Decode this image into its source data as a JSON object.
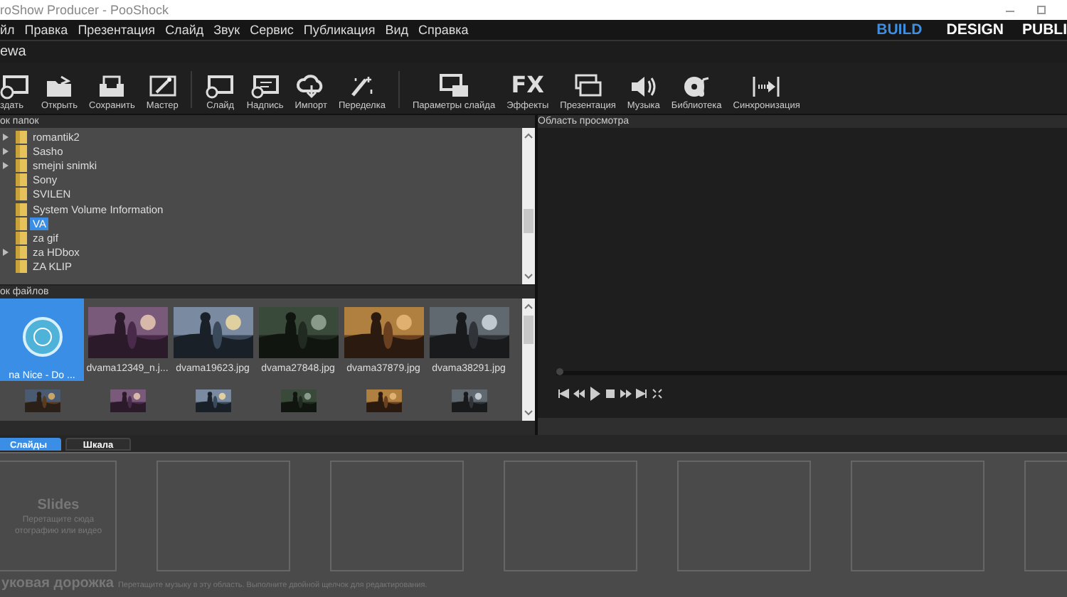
{
  "window": {
    "title": "roShow Producer - PooShock"
  },
  "menu": [
    "йл",
    "Правка",
    "Презентация",
    "Слайд",
    "Звук",
    "Сервис",
    "Публикация",
    "Вид",
    "Справка"
  ],
  "modes": [
    {
      "label": "BUILD",
      "selected": true
    },
    {
      "label": "DESIGN",
      "selected": false
    },
    {
      "label": "PUBLI",
      "selected": false
    }
  ],
  "project_tab": "ewa",
  "toolbar": [
    {
      "label": "здать"
    },
    {
      "label": "Открыть"
    },
    {
      "label": "Сохранить"
    },
    {
      "label": "Мастер",
      "group_end": true
    },
    {
      "label": "Слайд"
    },
    {
      "label": "Надпись"
    },
    {
      "label": "Импорт"
    },
    {
      "label": "Переделка",
      "group_end": true
    },
    {
      "label": "Параметры слайда"
    },
    {
      "label": "Эффекты",
      "icon_text": "FX"
    },
    {
      "label": "Презентация"
    },
    {
      "label": "Музыка"
    },
    {
      "label": "Библиотека"
    },
    {
      "label": "Синхронизация"
    }
  ],
  "folders": {
    "title": "ок папок",
    "items": [
      {
        "name": "romantik2",
        "has_children": true,
        "selected": false
      },
      {
        "name": "Sasho",
        "has_children": true,
        "selected": false
      },
      {
        "name": "smejni snimki",
        "has_children": true,
        "selected": false
      },
      {
        "name": "Sony",
        "has_children": false,
        "selected": false
      },
      {
        "name": "SVILEN",
        "has_children": false,
        "selected": false
      },
      {
        "name": "System Volume Information",
        "has_children": false,
        "selected": false
      },
      {
        "name": "VA",
        "has_children": false,
        "selected": true
      },
      {
        "name": "za gif",
        "has_children": false,
        "selected": false
      },
      {
        "name": "za HDbox",
        "has_children": true,
        "selected": false
      },
      {
        "name": "ZA KLIP",
        "has_children": false,
        "selected": false
      }
    ]
  },
  "files": {
    "title": "ок файлов",
    "items": [
      {
        "kind": "audio",
        "name": "na Nice - Do ...",
        "selected": true
      },
      {
        "kind": "picture",
        "name": "dvama12349_n.j...",
        "selected": false
      },
      {
        "kind": "picture",
        "name": "dvama19623.jpg",
        "selected": false
      },
      {
        "kind": "picture",
        "name": "dvama27848.jpg",
        "selected": false
      },
      {
        "kind": "picture",
        "name": "dvama37879.jpg",
        "selected": false
      },
      {
        "kind": "picture",
        "name": "dvama38291.jpg",
        "selected": false
      },
      {
        "kind": "picture",
        "selected": false
      },
      {
        "kind": "picture",
        "selected": false
      },
      {
        "kind": "picture",
        "selected": false
      },
      {
        "kind": "picture",
        "selected": false
      },
      {
        "kind": "picture",
        "selected": false
      },
      {
        "kind": "picture",
        "selected": false
      }
    ]
  },
  "preview": {
    "title": "Область просмотра",
    "level": 0
  },
  "bottom_tabs": [
    {
      "label": "Слайды",
      "selected": true
    },
    {
      "label": "Шкала",
      "selected": false
    }
  ],
  "slides": {
    "title": "Slides",
    "hint_1": "Перетащите сюда",
    "hint_2": "отографию или видео"
  },
  "audio_track": {
    "title": "уковая дорожка",
    "hint": "Перетащите музыку в эту область. Выполните двойной щелчок для редактирования."
  }
}
